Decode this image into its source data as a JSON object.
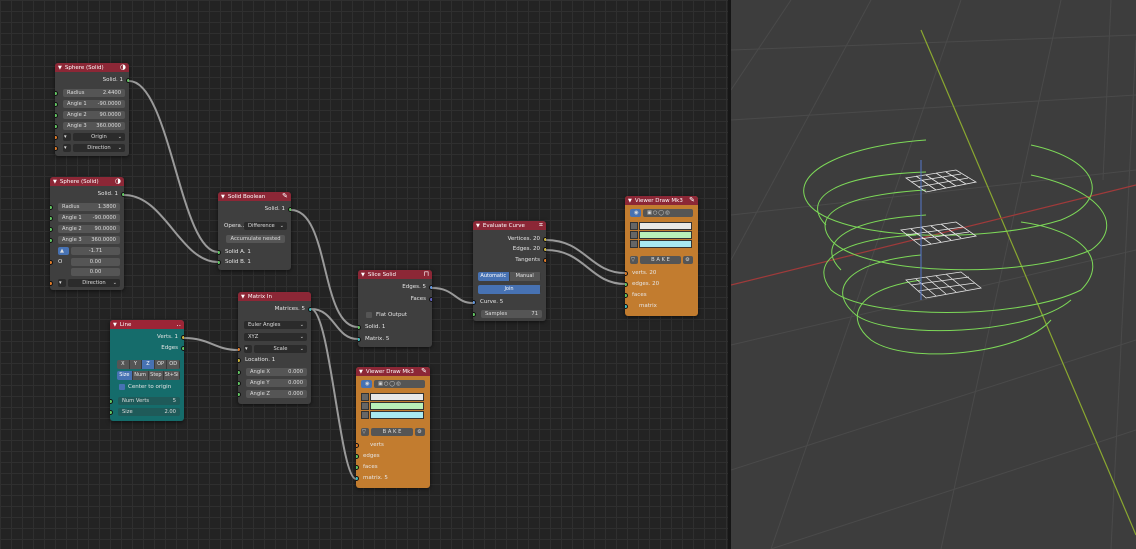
{
  "nodes": {
    "sphere1": {
      "title": "Sphere (Solid)",
      "out": "Solid. 1",
      "radius_label": "Radius",
      "radius": "2.4400",
      "a1_label": "Angle 1",
      "a1": "-90.0000",
      "a2_label": "Angle 2",
      "a2": "90.0000",
      "a3_label": "Angle 3",
      "a3": "360.0000",
      "origin": "Origin",
      "direction": "Direction"
    },
    "sphere2": {
      "title": "Sphere (Solid)",
      "out": "Solid. 1",
      "radius_label": "Radius",
      "radius": "1.3800",
      "a1_label": "Angle 1",
      "a1": "-90.0000",
      "a2_label": "Angle 2",
      "a2": "90.0000",
      "a3_label": "Angle 3",
      "a3": "360.0000",
      "v1": "-1.71",
      "v2": "0.00",
      "v3": "0.00",
      "o_label": "O",
      "direction": "Direction"
    },
    "boolean": {
      "title": "Solid Boolean",
      "out": "Solid. 1",
      "op_label": "Opera...",
      "op": "Difference",
      "accum": "Accumulate nested",
      "in_a": "Solid A. 1",
      "in_b": "Solid B. 1"
    },
    "line": {
      "title": "Line",
      "out_verts": "Verts. 1",
      "out_edges": "Edges",
      "axes": [
        "X",
        "Y",
        "Z",
        "OP",
        "OD"
      ],
      "modes": [
        "Size",
        "Num",
        "Step",
        "St+Si"
      ],
      "center": "Center to origin",
      "numverts_label": "Num Verts",
      "numverts": "5",
      "size_label": "Size",
      "size": "2.00"
    },
    "matrix": {
      "title": "Matrix In",
      "out": "Matrices. 5",
      "euler": "Euler Angles",
      "order": "XYZ",
      "scale": "Scale",
      "loc": "Location. 1",
      "ax_label": "Angle X",
      "ax": "0.000",
      "ay_label": "Angle Y",
      "ay": "0.000",
      "az_label": "Angle Z",
      "az": "0.000"
    },
    "slice": {
      "title": "Slice Solid",
      "out_edges": "Edges. 5",
      "out_faces": "Faces",
      "flat": "Flat Output",
      "in_solid": "Solid. 1",
      "in_matrix": "Matrix. 5"
    },
    "evaluate": {
      "title": "Evaluate Curve",
      "out_v": "Vertices. 20",
      "out_e": "Edges. 20",
      "out_t": "Tangents",
      "auto": "Automatic",
      "manual": "Manual",
      "join": "Join",
      "in_curve": "Curve. 5",
      "samples_label": "Samples",
      "samples": "71"
    },
    "viewer1": {
      "title": "Viewer Draw Mk3",
      "bake": "B A K E",
      "verts": "verts",
      "edges": "edges",
      "faces": "faces",
      "matrix": "matrix. 5"
    },
    "viewer2": {
      "title": "Viewer Draw Mk3",
      "bake": "B A K E",
      "verts": "verts. 20",
      "edges": "edges. 20",
      "faces": "faces",
      "matrix": "matrix"
    }
  },
  "colors": {
    "header": "#8c2736",
    "teal": "#156c6b",
    "orange": "#c27c2f",
    "wire": "#7dd958"
  }
}
